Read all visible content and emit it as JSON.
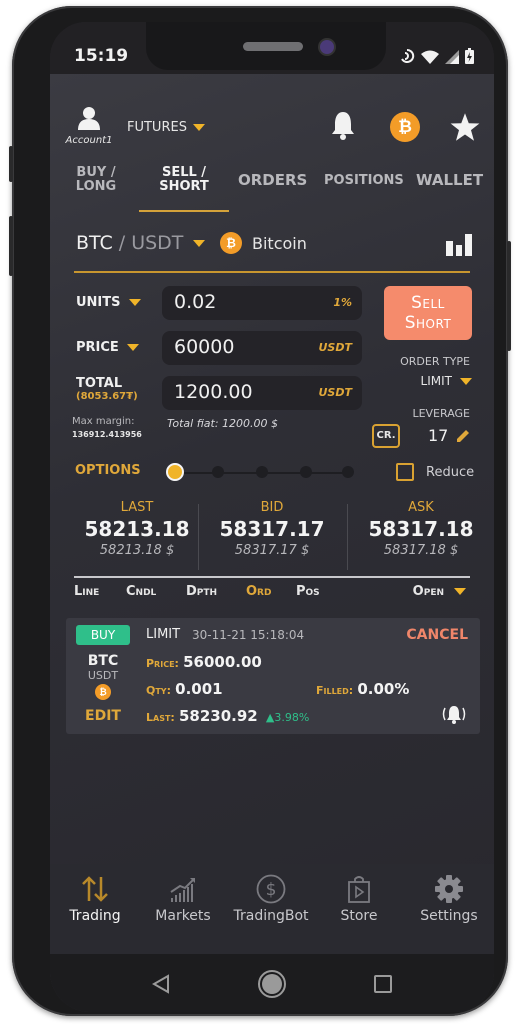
{
  "status_bar": {
    "time": "15:19"
  },
  "topbar": {
    "account_label": "Account1",
    "market_type": "FUTURES"
  },
  "tabs": [
    {
      "label_line1": "BUY /",
      "label_line2": "LONG",
      "active": false
    },
    {
      "label_line1": "SELL /",
      "label_line2": "SHORT",
      "active": true
    },
    {
      "label": "ORDERS",
      "active": false
    },
    {
      "label": "POSITIONS",
      "active": false
    },
    {
      "label": "WALLET",
      "active": false
    }
  ],
  "pair": {
    "base": "BTC",
    "separator": "/",
    "quote": "USDT",
    "coin_name": "Bitcoin",
    "coin_symbol": "₿"
  },
  "form": {
    "units": {
      "label": "UNITS",
      "value": "0.02",
      "unit": "1%"
    },
    "price": {
      "label": "PRICE",
      "value": "60000",
      "unit": "USDT"
    },
    "total": {
      "label": "TOTAL",
      "balance": "(8053.67₮)",
      "value": "1200.00",
      "unit": "USDT"
    },
    "max_margin_label": "Max margin:",
    "max_margin_value": "136912.413956",
    "total_fiat": "Total fiat: 1200.00 $"
  },
  "action": {
    "sell_line1": "Sell",
    "sell_line2": "Short",
    "order_type_label": "ORDER TYPE",
    "order_type_value": "LIMIT",
    "leverage_label": "LEVERAGE",
    "leverage_value": "17",
    "cross_label": "CR."
  },
  "options": {
    "label": "OPTIONS",
    "slider_steps": 5,
    "slider_selected_index": 0,
    "reduce_label": "Reduce",
    "reduce_checked": false
  },
  "prices": {
    "last": {
      "label": "LAST",
      "value": "58213.18",
      "fiat": "58213.18 $"
    },
    "bid": {
      "label": "BID",
      "value": "58317.17",
      "fiat": "58317.17 $"
    },
    "ask": {
      "label": "ASK",
      "value": "58317.18",
      "fiat": "58317.18 $"
    }
  },
  "chart_tabs": [
    {
      "label": "Line",
      "active": false
    },
    {
      "label": "Cndl",
      "active": false
    },
    {
      "label": "Dpth",
      "active": false
    },
    {
      "label": "Ord",
      "active": true
    },
    {
      "label": "Pos",
      "active": false
    }
  ],
  "filter": {
    "label": "Open"
  },
  "orders": [
    {
      "side": "BUY",
      "type": "LIMIT",
      "datetime": "30-11-21 15:18:04",
      "cancel_label": "CANCEL",
      "base": "BTC",
      "quote": "USDT",
      "edit_label": "EDIT",
      "price_label": "Price:",
      "price": "56000.00",
      "qty_label": "Qty:",
      "qty": "0.001",
      "filled_label": "Filled:",
      "filled": "0.00%",
      "last_label": "Last:",
      "last": "58230.92",
      "change": "▲3.98%"
    }
  ],
  "bottom_nav": [
    {
      "label": "Trading",
      "icon": "trading-arrows-icon",
      "active": true
    },
    {
      "label": "Markets",
      "icon": "markets-chart-icon",
      "active": false
    },
    {
      "label": "TradingBot",
      "icon": "dollar-circle-icon",
      "active": false
    },
    {
      "label": "Store",
      "icon": "store-bag-icon",
      "active": false
    },
    {
      "label": "Settings",
      "icon": "gear-icon",
      "active": false
    }
  ],
  "colors": {
    "accent": "#e0a83a",
    "sell": "#f58b6c",
    "buy": "#2fbf8a",
    "cancel": "#f0866a",
    "bitcoin": "#f39c28"
  }
}
